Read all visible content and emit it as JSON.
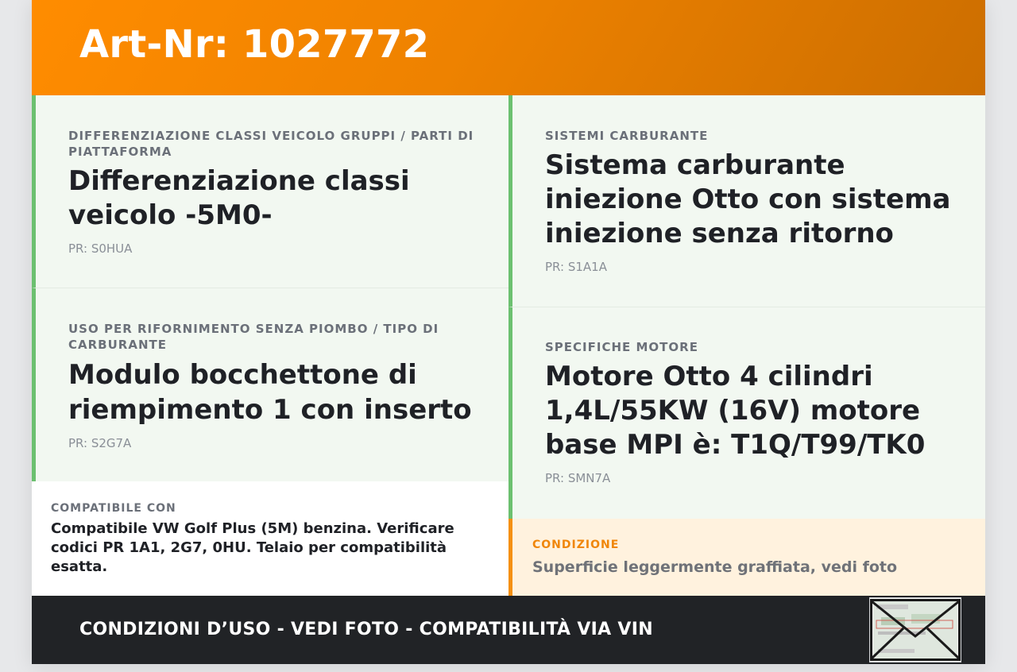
{
  "header": {
    "title": "Art-Nr: 1027772"
  },
  "features": [
    {
      "category": "DIFFERENZIAZIONE CLASSI VEICOLO GRUPPI / PARTI DI PIATTAFORMA",
      "title": "Differenziazione classi veicolo -5M0-",
      "pr": "PR: S0HUA"
    },
    {
      "category": "USO PER RIFORNIMENTO SENZA PIOMBO / TIPO DI CARBURANTE",
      "title": "Modulo bocchettone di riempimento 1 con inserto",
      "pr": "PR: S2G7A"
    },
    {
      "category": "SISTEMI CARBURANTE",
      "title": "Sistema carburante iniezione Otto con sistema iniezione senza ritorno",
      "pr": "PR: S1A1A"
    },
    {
      "category": "SPECIFICHE MOTORE",
      "title": "Motore Otto 4 cilindri 1,4L/55KW (16V) motore base MPI è: T1Q/T99/TK0",
      "pr": "PR: SMN7A"
    }
  ],
  "compat": {
    "label": "COMPATIBILE CON",
    "text": "Compatibile VW Golf Plus (5M) benzina. Verificare codici PR 1A1, 2G7, 0HU. Telaio per compatibilità esatta."
  },
  "condition": {
    "label": "CONDIZIONE",
    "text": "Superficie leggermente graffiata, vedi foto"
  },
  "footer": {
    "text": "CONDIZIONI D’USO - VEDI FOTO - COMPATIBILITÀ VIA VIN"
  },
  "colors": {
    "accent_orange": "#ff8c00",
    "feature_border": "#6cc070",
    "feature_bg": "#f2f8f1",
    "condition_bg": "#fff2de",
    "footer_bg": "#212326"
  }
}
